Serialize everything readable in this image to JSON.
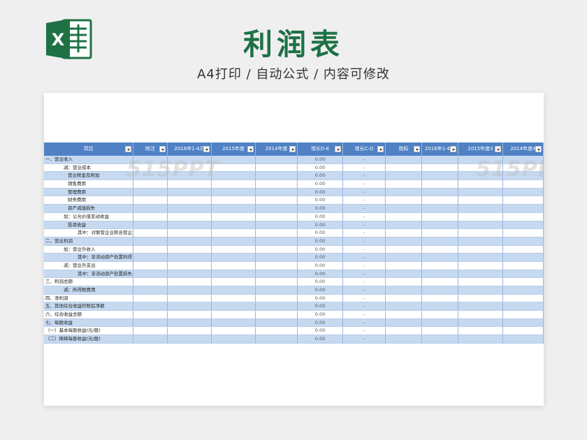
{
  "header": {
    "title": "利润表",
    "subtitle": "A4打印 / 自动公式 / 内容可修改",
    "logo_letter": "X"
  },
  "colors": {
    "brand_green": "#1e7145",
    "header_blue": "#4f81c4",
    "row_blue": "#c5d9f1"
  },
  "watermark": "515PPT",
  "table": {
    "columns": [
      "项目",
      "附注",
      "2016年1-4月",
      "2015年度",
      "2014年度",
      "增长D-E",
      "增长C-D",
      "指标",
      "2016年1-4月",
      "2015年度3",
      "2014年度4"
    ],
    "rows": [
      {
        "label": "一、营业收入",
        "indent": 0,
        "d": "0.00",
        "e": "-"
      },
      {
        "label": "减：营业成本",
        "indent": 1,
        "d": "0.00",
        "e": "-"
      },
      {
        "label": "营业税金及附加",
        "indent": 2,
        "d": "0.00",
        "e": "-"
      },
      {
        "label": "销售费用",
        "indent": 2,
        "d": "0.00",
        "e": "-"
      },
      {
        "label": "管理费用",
        "indent": 2,
        "d": "0.00",
        "e": "-"
      },
      {
        "label": "财务费用",
        "indent": 2,
        "d": "0.00",
        "e": "-"
      },
      {
        "label": "资产减值损失",
        "indent": 2,
        "d": "0.00",
        "e": "-"
      },
      {
        "label": "加：公允价值变动收益",
        "indent": 1,
        "d": "0.00",
        "e": "-"
      },
      {
        "label": "投资收益",
        "indent": 2,
        "d": "0.00",
        "e": "-"
      },
      {
        "label": "其中：对联营企业和合营企业的投资收益",
        "indent": 3,
        "d": "0.00",
        "e": "-"
      },
      {
        "label": "二、营业利润",
        "indent": 0,
        "d": "0.00",
        "e": "-"
      },
      {
        "label": "加：营业外收入",
        "indent": 1,
        "d": "0.00",
        "e": "-"
      },
      {
        "label": "其中：非流动资产处置利得",
        "indent": 3,
        "d": "0.00",
        "e": "-"
      },
      {
        "label": "减：营业外支出",
        "indent": 1,
        "d": "0.00",
        "e": "-"
      },
      {
        "label": "其中：非流动资产处置损失",
        "indent": 3,
        "d": "0.00",
        "e": "-"
      },
      {
        "label": "三、利润总额",
        "indent": 0,
        "d": "0.00",
        "e": "-"
      },
      {
        "label": "减：所得税费用",
        "indent": 1,
        "d": "0.00",
        "e": "-"
      },
      {
        "label": "四、净利润",
        "indent": 0,
        "d": "0.00",
        "e": "-"
      },
      {
        "label": "五、其他综合收益的税后净额",
        "indent": 0,
        "d": "0.00",
        "e": "-"
      },
      {
        "label": "六、综合收益总额",
        "indent": 0,
        "d": "0.00",
        "e": "-"
      },
      {
        "label": "七、每股收益",
        "indent": 0,
        "d": "0.00",
        "e": "-"
      },
      {
        "label": "（一）基本每股收益(元/股)",
        "indent": 0,
        "d": "0.00",
        "e": "-"
      },
      {
        "label": "（二）稀释每股收益(元/股)",
        "indent": 0,
        "d": "0.00",
        "e": "-"
      }
    ]
  }
}
